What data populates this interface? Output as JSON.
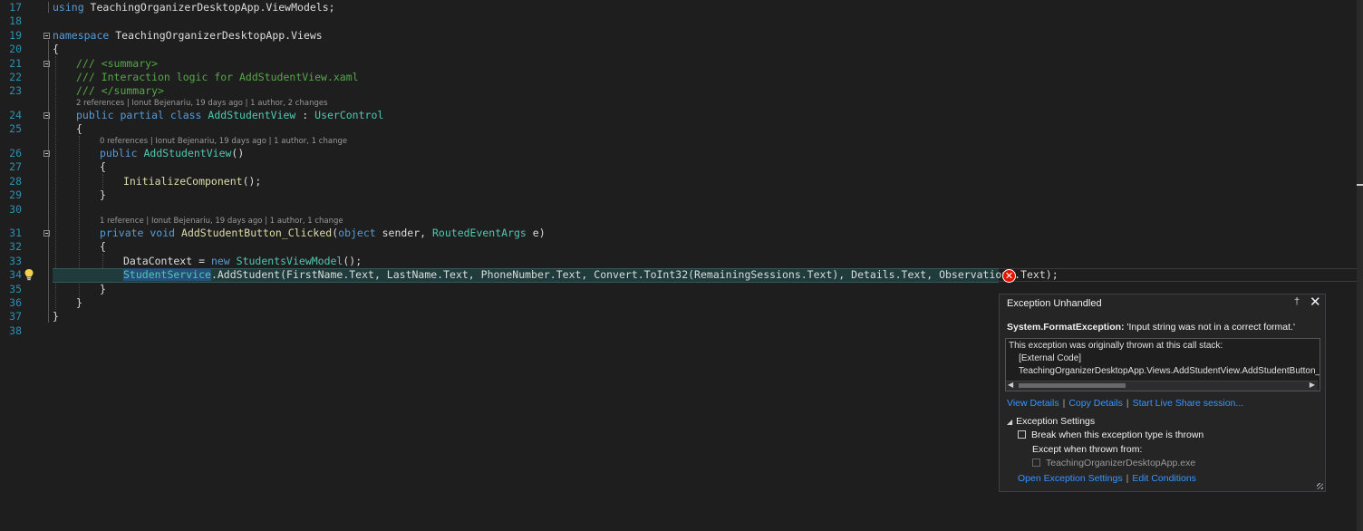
{
  "editor": {
    "lines": [
      {
        "num": "17"
      },
      {
        "num": "18"
      },
      {
        "num": "19"
      },
      {
        "num": "20"
      },
      {
        "num": "21"
      },
      {
        "num": "22"
      },
      {
        "num": "23"
      },
      {
        "num": "24"
      },
      {
        "num": "25"
      },
      {
        "num": "26"
      },
      {
        "num": "27"
      },
      {
        "num": "28"
      },
      {
        "num": "29"
      },
      {
        "num": "30"
      },
      {
        "num": "31"
      },
      {
        "num": "32"
      },
      {
        "num": "33"
      },
      {
        "num": "34"
      },
      {
        "num": "35"
      },
      {
        "num": "36"
      },
      {
        "num": "37"
      },
      {
        "num": "38"
      }
    ],
    "code": {
      "l17_kw": "using",
      "l17_rest": " TeachingOrganizerDesktopApp.ViewModels;",
      "l19_kw": "namespace",
      "l19_rest": " TeachingOrganizerDesktopApp.Views",
      "l20": "{",
      "l21": "/// <summary>",
      "l22": "/// Interaction logic for AddStudentView.xaml",
      "l23": "/// </summary>",
      "l24_kw": "public partial class",
      "l24_name": "AddStudentView",
      "l24_mid": " : ",
      "l24_base": "UserControl",
      "l25": "{",
      "l26_kw": "public",
      "l26_name": "AddStudentView",
      "l26_rest": "()",
      "l27": "{",
      "l28_fn": "InitializeComponent",
      "l28_rest": "();",
      "l29": "}",
      "l31_kw": "private void",
      "l31_fn": "AddStudentButton_Clicked",
      "l31_p1": "(",
      "l31_kw2": "object",
      "l31_p2": " sender, ",
      "l31_ty": "RoutedEventArgs",
      "l31_p3": " e)",
      "l32": "{",
      "l33_a": "DataContext = ",
      "l33_kw": "new",
      "l33_ty": "StudentsViewModel",
      "l33_rest": "();",
      "l34_sel": "StudentService",
      "l34_rest": ".AddStudent(FirstName.Text, LastName.Text, PhoneNumber.Text, Convert.ToInt32(RemainingSessions.Text), Details.Text, Observations.Text);",
      "l35": "}",
      "l36": "}",
      "l37": "}"
    },
    "codelens": {
      "class_lens": "2 references | Ionut Bejenariu, 19 days ago | 1 author, 2 changes",
      "ctor_lens": "0 references | Ionut Bejenariu, 19 days ago | 1 author, 1 change",
      "method_lens": "1 reference | Ionut Bejenariu, 19 days ago | 1 author, 1 change"
    }
  },
  "exception": {
    "title": "Exception Unhandled",
    "pin_glyph": "†",
    "close_glyph": "✕",
    "type": "System.FormatException:",
    "message": " 'Input string was not in a correct format.'",
    "stack": [
      "This exception was originally thrown at this call stack:",
      "    [External Code]",
      "    TeachingOrganizerDesktopApp.Views.AddStudentView.AddStudentButton_Clicked(object, System.Windows.RoutedEventArgs)"
    ],
    "links": [
      "View Details",
      "Copy Details",
      "Start Live Share session..."
    ],
    "settings_header": "Exception Settings",
    "break_label": "Break when this exception type is thrown",
    "except_label": "Except when thrown from:",
    "module_label": "TeachingOrganizerDesktopApp.exe",
    "bottom_links": [
      "Open Exception Settings",
      "Edit Conditions"
    ]
  },
  "icons": {
    "error": "error-icon",
    "bulb": "lightbulb-icon"
  },
  "colors": {
    "background": "#1e1e1e",
    "keyword": "#569cd6",
    "type": "#4ec9b0",
    "comment": "#57a64a",
    "line_number": "#2b91af",
    "error": "#e51400",
    "link": "#3794ff"
  }
}
